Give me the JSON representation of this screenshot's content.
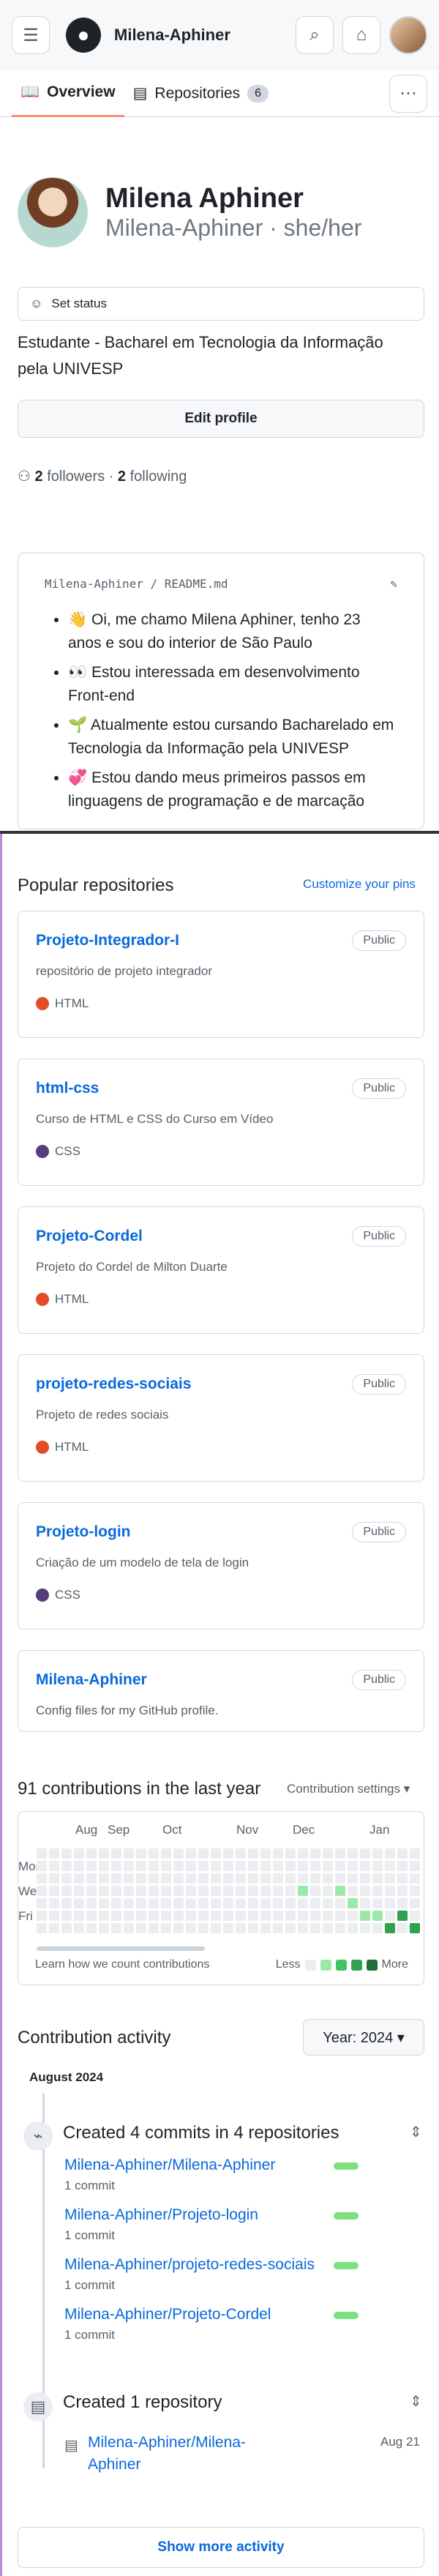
{
  "header": {
    "username": "Milena-Aphiner"
  },
  "tabs": [
    {
      "label": "Overview"
    },
    {
      "label": "Repositories",
      "count": "6"
    }
  ],
  "profile": {
    "full_name": "Milena Aphiner",
    "login_pronouns": "Milena-Aphiner · she/her",
    "set_status": "Set status",
    "bio": "Estudante - Bacharel em Tecnologia da Informação pela UNIVESP",
    "edit_button": "Edit profile",
    "followers_count": "2",
    "followers_label": "followers",
    "following_count": "2",
    "following_label": "following"
  },
  "readme": {
    "path_user": "Milena-Aphiner",
    "path_separator": "/",
    "path_file": "README",
    "path_ext": ".md",
    "items": [
      "👋 Oi, me chamo Milena Aphiner, tenho 23 anos e sou do interior de São Paulo",
      "👀 Estou interessada em desenvolvimento Front-end",
      "🌱 Atualmente estou cursando Bacharelado em Tecnologia da Informação pela UNIVESP",
      "💞️ Estou dando meus primeiros passos em linguagens de programação e de marcação"
    ]
  },
  "popular": {
    "title": "Popular repositories",
    "customize": "Customize your pins",
    "repos": [
      {
        "name": "Projeto-Integrador-I",
        "visibility": "Public",
        "description": "repositório de projeto integrador",
        "language": "HTML",
        "color": "#e34c26"
      },
      {
        "name": "html-css",
        "visibility": "Public",
        "description": "Curso de HTML e CSS do Curso em Vídeo",
        "language": "CSS",
        "color": "#563d7c"
      },
      {
        "name": "Projeto-Cordel",
        "visibility": "Public",
        "description": "Projeto do Cordel de Milton Duarte",
        "language": "HTML",
        "color": "#e34c26"
      },
      {
        "name": "projeto-redes-sociais",
        "visibility": "Public",
        "description": "Projeto de redes sociais",
        "language": "HTML",
        "color": "#e34c26"
      },
      {
        "name": "Projeto-login",
        "visibility": "Public",
        "description": "Criação de um modelo de tela de login",
        "language": "CSS",
        "color": "#563d7c"
      },
      {
        "name": "Milena-Aphiner",
        "visibility": "Public",
        "description": "Config files for my GitHub profile.",
        "language": "",
        "color": ""
      }
    ]
  },
  "contributions": {
    "title": "91 contributions in the last year",
    "settings": "Contribution settings ▾",
    "months": [
      "Aug",
      "Sep",
      "Oct",
      "Nov",
      "Dec",
      "Jan"
    ],
    "days": [
      "Mon",
      "Wed",
      "Fri"
    ],
    "learn": "Learn how we count contributions",
    "less": "Less",
    "more": "More",
    "legend_colors": [
      "#ebedf0",
      "#9be9a8",
      "#40c463",
      "#30a14e",
      "#216e39"
    ]
  },
  "activity": {
    "title": "Contribution activity",
    "year_button": "Year: 2024 ▾",
    "month": "August 2024",
    "commit_title": "Created 4 commits in 4 repositories",
    "commit_repos": [
      {
        "name": "Milena-Aphiner/Milena-Aphiner",
        "count": "1 commit"
      },
      {
        "name": "Milena-Aphiner/Projeto-login",
        "count": "1 commit"
      },
      {
        "name": "Milena-Aphiner/projeto-redes-sociais",
        "count": "1 commit"
      },
      {
        "name": "Milena-Aphiner/Projeto-Cordel",
        "count": "1 commit"
      }
    ],
    "repo_title": "Created 1 repository",
    "created_repo": "Milena-Aphiner/Milena-Aphiner",
    "created_date": "Aug 21",
    "show_more": "Show more activity"
  },
  "icons": [
    "hamburger-menu-icon",
    "github-logo-icon",
    "search-icon",
    "inbox-icon",
    "book-icon",
    "repo-icon",
    "people-icon",
    "pencil-icon",
    "commit-icon",
    "fold-icon"
  ]
}
